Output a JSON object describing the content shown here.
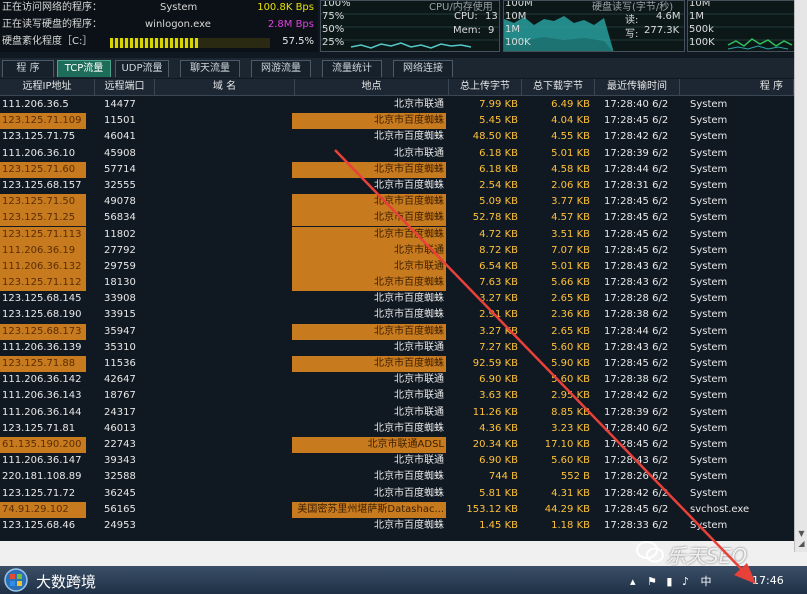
{
  "status": {
    "net_access_label": "正在访问网络的程序：",
    "net_access_value": "System",
    "net_access_speed": "100.8K Bps",
    "disk_rw_label": "正在读写硬盘的程序：",
    "disk_rw_value": "winlogon.exe",
    "disk_rw_speed": "2.8M Bps",
    "frag_label": "硬盘紊化程度［C:］",
    "frag_value": "57.5%",
    "frag_fraction": 0.575
  },
  "cpu_panel": {
    "ticks": [
      "100%",
      "75%",
      "50%",
      "25%"
    ],
    "title": "CPU/内存使用",
    "cpu_label": "CPU:",
    "cpu_value": "13",
    "mem_label": "Mem:",
    "mem_value": "9"
  },
  "disk_panel": {
    "ticks": [
      "100M",
      "10M",
      "1M",
      "100K"
    ],
    "title": "硬盘读写(字节/秒)",
    "read_label": "读:",
    "read_value": "4.6M",
    "write_label": "写:",
    "write_value": "277.3K"
  },
  "net_panel": {
    "ticks": [
      "10M",
      "1M",
      "500k",
      "100K"
    ]
  },
  "tabs": [
    "程 序",
    "TCP流量",
    "UDP流量",
    "聊天流量",
    "网游流量",
    "流量统计",
    "网络连接"
  ],
  "active_tab": 1,
  "columns": [
    "远程IP地址",
    "远程端口",
    "域 名",
    "地点",
    "总上传字节",
    "总下载字节",
    "最近传输时间",
    "程 序"
  ],
  "rows": [
    {
      "ip": "111.206.36.5",
      "port": "14477",
      "loc": "北京市联通",
      "up": "7.99 KB",
      "down": "6.49 KB",
      "time": "17:28:40 6/2",
      "proc": "System",
      "hl": false
    },
    {
      "ip": "123.125.71.109",
      "port": "11501",
      "loc": "北京市百度蜘蛛",
      "up": "5.45 KB",
      "down": "4.04 KB",
      "time": "17:28:45 6/2",
      "proc": "System",
      "hl": true
    },
    {
      "ip": "123.125.71.75",
      "port": "46041",
      "loc": "北京市百度蜘蛛",
      "up": "48.50 KB",
      "down": "4.55 KB",
      "time": "17:28:42 6/2",
      "proc": "System",
      "hl": false
    },
    {
      "ip": "111.206.36.10",
      "port": "45908",
      "loc": "北京市联通",
      "up": "6.18 KB",
      "down": "5.01 KB",
      "time": "17:28:39 6/2",
      "proc": "System",
      "hl": false
    },
    {
      "ip": "123.125.71.60",
      "port": "57714",
      "loc": "北京市百度蜘蛛",
      "up": "6.18 KB",
      "down": "4.58 KB",
      "time": "17:28:44 6/2",
      "proc": "System",
      "hl": true
    },
    {
      "ip": "123.125.68.157",
      "port": "32555",
      "loc": "北京市百度蜘蛛",
      "up": "2.54 KB",
      "down": "2.06 KB",
      "time": "17:28:31 6/2",
      "proc": "System",
      "hl": false
    },
    {
      "ip": "123.125.71.50",
      "port": "49078",
      "loc": "北京市百度蜘蛛",
      "up": "5.09 KB",
      "down": "3.77 KB",
      "time": "17:28:45 6/2",
      "proc": "System",
      "hl": true
    },
    {
      "ip": "123.125.71.25",
      "port": "56834",
      "loc": "北京市百度蜘蛛",
      "up": "52.78 KB",
      "down": "4.57 KB",
      "time": "17:28:45 6/2",
      "proc": "System",
      "hl": true
    },
    {
      "ip": "123.125.71.113",
      "port": "11802",
      "loc": "北京市百度蜘蛛",
      "up": "4.72 KB",
      "down": "3.51 KB",
      "time": "17:28:45 6/2",
      "proc": "System",
      "hl": true
    },
    {
      "ip": "111.206.36.19",
      "port": "27792",
      "loc": "北京市联通",
      "up": "8.72 KB",
      "down": "7.07 KB",
      "time": "17:28:45 6/2",
      "proc": "System",
      "hl": true
    },
    {
      "ip": "111.206.36.132",
      "port": "29759",
      "loc": "北京市联通",
      "up": "6.54 KB",
      "down": "5.01 KB",
      "time": "17:28:43 6/2",
      "proc": "System",
      "hl": true
    },
    {
      "ip": "123.125.71.112",
      "port": "18130",
      "loc": "北京市百度蜘蛛",
      "up": "7.63 KB",
      "down": "5.66 KB",
      "time": "17:28:43 6/2",
      "proc": "System",
      "hl": true
    },
    {
      "ip": "123.125.68.145",
      "port": "33908",
      "loc": "北京市百度蜘蛛",
      "up": "3.27 KB",
      "down": "2.65 KB",
      "time": "17:28:28 6/2",
      "proc": "System",
      "hl": false
    },
    {
      "ip": "123.125.68.190",
      "port": "33915",
      "loc": "北京市百度蜘蛛",
      "up": "2.91 KB",
      "down": "2.36 KB",
      "time": "17:28:38 6/2",
      "proc": "System",
      "hl": false
    },
    {
      "ip": "123.125.68.173",
      "port": "35947",
      "loc": "北京市百度蜘蛛",
      "up": "3.27 KB",
      "down": "2.65 KB",
      "time": "17:28:44 6/2",
      "proc": "System",
      "hl": true
    },
    {
      "ip": "111.206.36.139",
      "port": "35310",
      "loc": "北京市联通",
      "up": "7.27 KB",
      "down": "5.60 KB",
      "time": "17:28:43 6/2",
      "proc": "System",
      "hl": false
    },
    {
      "ip": "123.125.71.88",
      "port": "11536",
      "loc": "北京市百度蜘蛛",
      "up": "92.59 KB",
      "down": "5.90 KB",
      "time": "17:28:45 6/2",
      "proc": "System",
      "hl": true
    },
    {
      "ip": "111.206.36.142",
      "port": "42647",
      "loc": "北京市联通",
      "up": "6.90 KB",
      "down": "5.60 KB",
      "time": "17:28:38 6/2",
      "proc": "System",
      "hl": false
    },
    {
      "ip": "111.206.36.143",
      "port": "18767",
      "loc": "北京市联通",
      "up": "3.63 KB",
      "down": "2.95 KB",
      "time": "17:28:42 6/2",
      "proc": "System",
      "hl": false
    },
    {
      "ip": "111.206.36.144",
      "port": "24317",
      "loc": "北京市联通",
      "up": "11.26 KB",
      "down": "8.85 KB",
      "time": "17:28:39 6/2",
      "proc": "System",
      "hl": false
    },
    {
      "ip": "123.125.71.81",
      "port": "46013",
      "loc": "北京市百度蜘蛛",
      "up": "4.36 KB",
      "down": "3.23 KB",
      "time": "17:28:40 6/2",
      "proc": "System",
      "hl": false
    },
    {
      "ip": "61.135.190.200",
      "port": "22743",
      "loc": "北京市联通ADSL",
      "up": "20.34 KB",
      "down": "17.10 KB",
      "time": "17:28:45 6/2",
      "proc": "System",
      "hl": true
    },
    {
      "ip": "111.206.36.147",
      "port": "39343",
      "loc": "北京市联通",
      "up": "6.90 KB",
      "down": "5.60 KB",
      "time": "17:28:43 6/2",
      "proc": "System",
      "hl": false
    },
    {
      "ip": "220.181.108.89",
      "port": "32588",
      "loc": "北京市百度蜘蛛",
      "up": "744 B",
      "down": "552 B",
      "time": "17:28:26 6/2",
      "proc": "System",
      "hl": false
    },
    {
      "ip": "123.125.71.72",
      "port": "36245",
      "loc": "北京市百度蜘蛛",
      "up": "5.81 KB",
      "down": "4.31 KB",
      "time": "17:28:42 6/2",
      "proc": "System",
      "hl": false
    },
    {
      "ip": "74.91.29.102",
      "port": "56165",
      "loc": "美国密苏里州堪萨斯Datashac...",
      "up": "153.12 KB",
      "down": "44.29 KB",
      "time": "17:28:45 6/2",
      "proc": "svchost.exe",
      "hl": true
    },
    {
      "ip": "123.125.68.46",
      "port": "24953",
      "loc": "北京市百度蜘蛛",
      "up": "1.45 KB",
      "down": "1.18 KB",
      "time": "17:28:33 6/2",
      "proc": "System",
      "hl": false
    }
  ],
  "watermark": "乐天SEO",
  "taskbar": {
    "label": "大数跨境",
    "ime": "中",
    "clock": "17:46"
  },
  "colors": {
    "highlight": "#c87a1e",
    "bytes": "#ffc23a",
    "active_tab": "#1e6d5a",
    "annotation_arrow": "#e8413a"
  }
}
